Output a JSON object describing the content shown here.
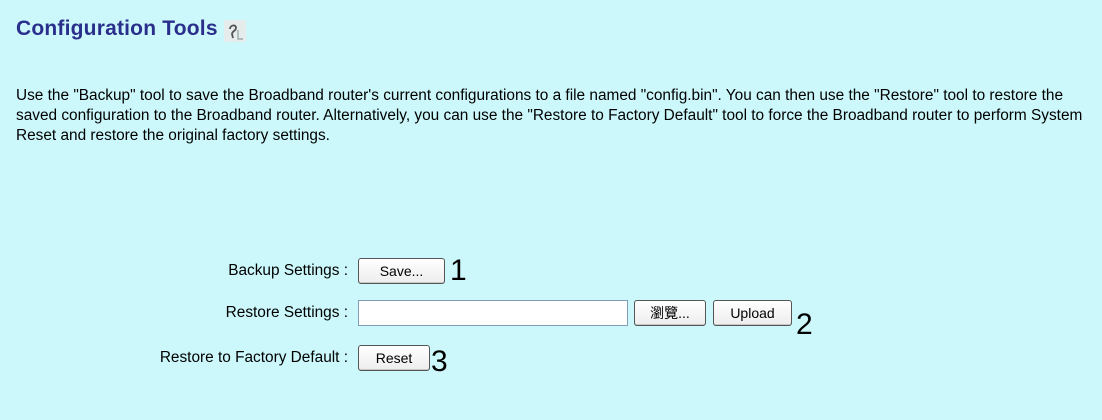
{
  "page": {
    "title": "Configuration Tools",
    "help_icon": "help-icon",
    "description": "Use the \"Backup\" tool to save the Broadband router's current configurations to a file named \"config.bin\". You can then use the \"Restore\" tool to restore the saved configuration to the Broadband router. Alternatively, you can use the \"Restore to Factory Default\" tool to force the Broadband router to perform System Reset and restore the original factory settings."
  },
  "backup": {
    "label": "Backup Settings :",
    "button_label": "Save...",
    "marker": "1"
  },
  "restore": {
    "label": "Restore Settings :",
    "file_value": "",
    "browse_label": "瀏覽...",
    "upload_label": "Upload",
    "marker": "2"
  },
  "factory": {
    "label": "Restore to Factory Default :",
    "button_label": "Reset",
    "marker": "3"
  },
  "colors": {
    "background": "#ccf8fb",
    "title": "#2b2f8c"
  }
}
